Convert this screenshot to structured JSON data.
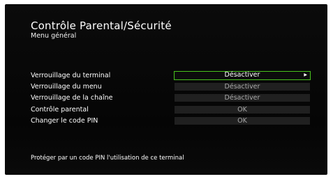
{
  "header": {
    "title": "Contrôle Parental/Sécurité",
    "subtitle": "Menu général"
  },
  "menu": {
    "items": [
      {
        "label": "Verrouillage du terminal",
        "value": "Désactiver",
        "selected": true
      },
      {
        "label": "Verrouillage du menu",
        "value": "Désactiver",
        "selected": false
      },
      {
        "label": "Verrouillage de la chaîne",
        "value": "Désactiver",
        "selected": false
      },
      {
        "label": "Contrôle parental",
        "value": "OK",
        "selected": false
      },
      {
        "label": "Changer le code PIN",
        "value": "OK",
        "selected": false
      }
    ],
    "arrow_icon": "triangle-right-icon"
  },
  "footer": {
    "help_text": "Protéger par un code PIN l'utilisation de ce terminal"
  },
  "colors": {
    "selection_border": "#49c21d",
    "value_background": "#202020",
    "background": "#0b0b0b"
  }
}
